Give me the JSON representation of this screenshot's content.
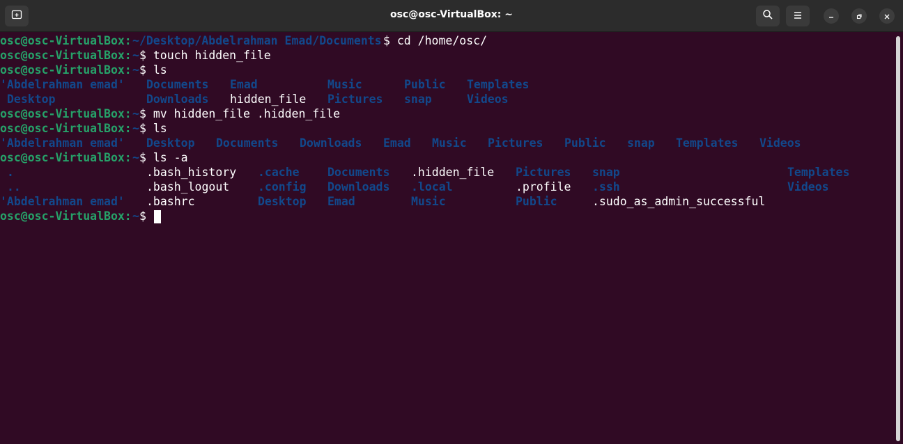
{
  "window": {
    "title": "osc@osc-VirtualBox: ~"
  },
  "colors": {
    "background": "#300a24",
    "prompt_user": "#26a269",
    "prompt_path": "#12488b",
    "directory": "#12488b",
    "text": "#ffffff"
  },
  "icons": {
    "new_tab": "new-tab-icon",
    "search": "search-icon",
    "menu": "hamburger-menu-icon",
    "minimize": "minimize-icon",
    "maximize": "maximize-icon",
    "close": "close-icon"
  },
  "lines": [
    [
      {
        "t": "osc@osc-VirtualBox:",
        "c": "g"
      },
      {
        "t": "~/Desktop/Abdelrahman Emad/Documents",
        "c": "b"
      },
      {
        "t": "$ cd /home/osc/",
        "c": "w"
      }
    ],
    [
      {
        "t": "osc@osc-VirtualBox:",
        "c": "g"
      },
      {
        "t": "~",
        "c": "b"
      },
      {
        "t": "$ touch hidden_file",
        "c": "w"
      }
    ],
    [
      {
        "t": "osc@osc-VirtualBox:",
        "c": "g"
      },
      {
        "t": "~",
        "c": "b"
      },
      {
        "t": "$ ls",
        "c": "w"
      }
    ],
    [
      {
        "t": "'Abdelrahman emad'",
        "c": "d",
        "col": 0
      },
      {
        "t": "Documents",
        "c": "d",
        "col": 21
      },
      {
        "t": "Emad",
        "c": "d",
        "col": 33
      },
      {
        "t": "Music",
        "c": "d",
        "col": 47
      },
      {
        "t": "Public",
        "c": "d",
        "col": 58
      },
      {
        "t": "Templates",
        "c": "d",
        "col": 67
      }
    ],
    [
      {
        "t": "Desktop",
        "c": "d",
        "col": 1
      },
      {
        "t": "Downloads",
        "c": "d",
        "col": 21
      },
      {
        "t": "hidden_file",
        "c": "w",
        "col": 33
      },
      {
        "t": "Pictures",
        "c": "d",
        "col": 47
      },
      {
        "t": "snap",
        "c": "d",
        "col": 58
      },
      {
        "t": "Videos",
        "c": "d",
        "col": 67
      }
    ],
    [
      {
        "t": "osc@osc-VirtualBox:",
        "c": "g"
      },
      {
        "t": "~",
        "c": "b"
      },
      {
        "t": "$ mv hidden_file .hidden_file",
        "c": "w"
      }
    ],
    [
      {
        "t": "osc@osc-VirtualBox:",
        "c": "g"
      },
      {
        "t": "~",
        "c": "b"
      },
      {
        "t": "$ ls",
        "c": "w"
      }
    ],
    [
      {
        "t": "'Abdelrahman emad'",
        "c": "d",
        "col": 0
      },
      {
        "t": "Desktop",
        "c": "d",
        "col": 21
      },
      {
        "t": "Documents",
        "c": "d",
        "col": 31
      },
      {
        "t": "Downloads",
        "c": "d",
        "col": 43
      },
      {
        "t": "Emad",
        "c": "d",
        "col": 55
      },
      {
        "t": "Music",
        "c": "d",
        "col": 62
      },
      {
        "t": "Pictures",
        "c": "d",
        "col": 70
      },
      {
        "t": "Public",
        "c": "d",
        "col": 81
      },
      {
        "t": "snap",
        "c": "d",
        "col": 90
      },
      {
        "t": "Templates",
        "c": "d",
        "col": 97
      },
      {
        "t": "Videos",
        "c": "d",
        "col": 109
      }
    ],
    [
      {
        "t": "osc@osc-VirtualBox:",
        "c": "g"
      },
      {
        "t": "~",
        "c": "b"
      },
      {
        "t": "$ ls -a",
        "c": "w"
      }
    ],
    [
      {
        "t": ".",
        "c": "d",
        "col": 1
      },
      {
        "t": ".bash_history",
        "c": "w",
        "col": 21
      },
      {
        "t": ".cache",
        "c": "d",
        "col": 37
      },
      {
        "t": "Documents",
        "c": "d",
        "col": 47
      },
      {
        "t": ".hidden_file",
        "c": "w",
        "col": 59
      },
      {
        "t": "Pictures",
        "c": "d",
        "col": 74
      },
      {
        "t": "snap",
        "c": "d",
        "col": 85
      },
      {
        "t": "Templates",
        "c": "d",
        "col": 113
      }
    ],
    [
      {
        "t": "..",
        "c": "d",
        "col": 1
      },
      {
        "t": ".bash_logout",
        "c": "w",
        "col": 21
      },
      {
        "t": ".config",
        "c": "d",
        "col": 37
      },
      {
        "t": "Downloads",
        "c": "d",
        "col": 47
      },
      {
        "t": ".local",
        "c": "d",
        "col": 59
      },
      {
        "t": ".profile",
        "c": "w",
        "col": 74
      },
      {
        "t": ".ssh",
        "c": "d",
        "col": 85
      },
      {
        "t": "Videos",
        "c": "d",
        "col": 113
      }
    ],
    [
      {
        "t": "'Abdelrahman emad'",
        "c": "d",
        "col": 0
      },
      {
        "t": ".bashrc",
        "c": "w",
        "col": 21
      },
      {
        "t": "Desktop",
        "c": "d",
        "col": 37
      },
      {
        "t": "Emad",
        "c": "d",
        "col": 47
      },
      {
        "t": "Music",
        "c": "d",
        "col": 59
      },
      {
        "t": "Public",
        "c": "d",
        "col": 74
      },
      {
        "t": ".sudo_as_admin_successful",
        "c": "w",
        "col": 85
      }
    ],
    [
      {
        "t": "osc@osc-VirtualBox:",
        "c": "g"
      },
      {
        "t": "~",
        "c": "b"
      },
      {
        "t": "$ ",
        "c": "w"
      }
    ]
  ]
}
